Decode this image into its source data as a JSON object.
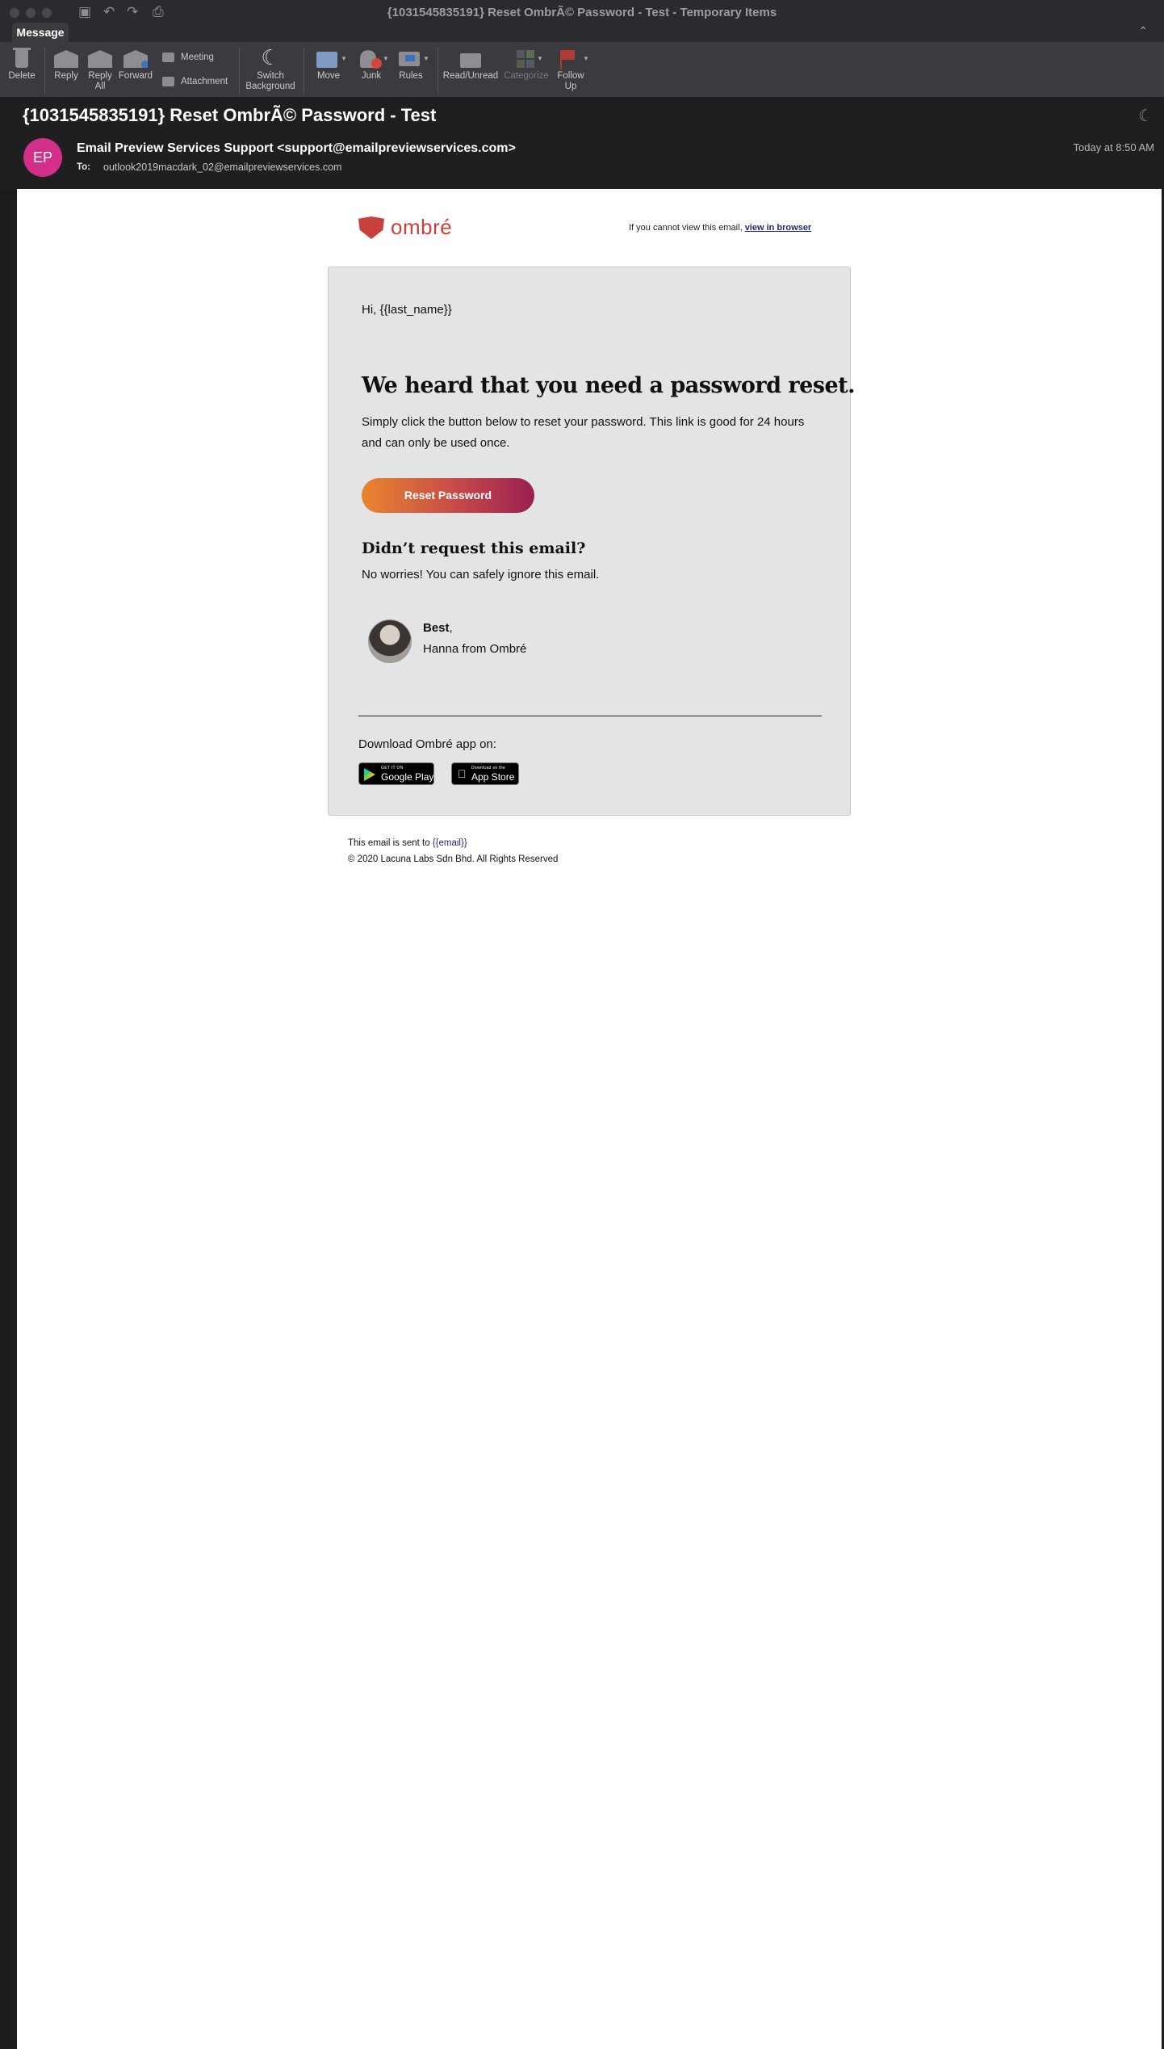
{
  "window": {
    "title": "{1031545835191} Reset OmbrÃ© Password - Test - Temporary Items"
  },
  "tabs": {
    "message": "Message"
  },
  "ribbon": {
    "delete": "Delete",
    "reply": "Reply",
    "reply_all_line1": "Reply",
    "reply_all_line2": "All",
    "forward": "Forward",
    "meeting": "Meeting",
    "attachment": "Attachment",
    "switch_bg_line1": "Switch",
    "switch_bg_line2": "Background",
    "move": "Move",
    "junk": "Junk",
    "rules": "Rules",
    "read_unread": "Read/Unread",
    "categorize": "Categorize",
    "follow_up_line1": "Follow",
    "follow_up_line2": "Up"
  },
  "message": {
    "subject": "{1031545835191} Reset OmbrÃ© Password - Test",
    "avatar_initials": "EP",
    "avatar_color": "#d22f8b",
    "sender": "Email Preview Services Support <support@emailpreviewservices.com>",
    "to_label": "To:",
    "to_address": "outlook2019macdark_02@emailpreviewservices.com",
    "date": "Today at 8:50 AM"
  },
  "email": {
    "brand": "ombré",
    "brand_color": "#c9413f",
    "view_browser_prefix": "If you cannot view this email,",
    "view_browser_link": "view in browser",
    "greeting": "Hi, {{last_name}}",
    "headline": "We heard that you need a password reset.",
    "body": "Simply click the button below to reset your password. This link is good for 24 hours and can only be used once.",
    "button": "Reset Password",
    "subhead": "Didn’t request this email?",
    "ignore_text": "No worries! You can safely ignore this email.",
    "sign_best": "Best",
    "sign_comma": ",",
    "sign_name": "Hanna from Ombré",
    "download_text": "Download Ombré app on:",
    "google_play_small": "GET IT ON",
    "google_play_big": "Google Play",
    "app_store_small": "Download on the",
    "app_store_big": "App Store",
    "footer_sent_prefix": "This email is sent to",
    "footer_sent_email": "{{email}}",
    "footer_copyright": "© 2020 Lacuna Labs Sdn Bhd. All Rights Reserved"
  }
}
